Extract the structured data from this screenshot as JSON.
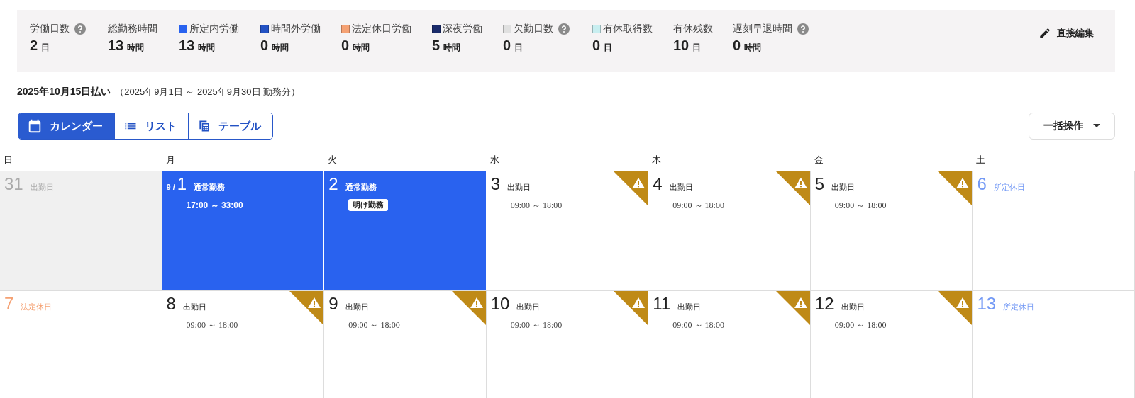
{
  "summary": {
    "items": [
      {
        "label": "労働日数",
        "value": "2",
        "unit": "日",
        "help": true
      },
      {
        "label": "総勤務時間",
        "value": "13",
        "unit": "時間",
        "help": false
      },
      {
        "label": "所定内労働",
        "value": "13",
        "unit": "時間",
        "help": false,
        "color": "#2962ef"
      },
      {
        "label": "時間外労働",
        "value": "0",
        "unit": "時間",
        "help": false,
        "color": "#2352c4"
      },
      {
        "label": "法定休日労働",
        "value": "0",
        "unit": "時間",
        "help": false,
        "color": "#f5a173"
      },
      {
        "label": "深夜労働",
        "value": "5",
        "unit": "時間",
        "help": false,
        "color": "#1a2b6b"
      },
      {
        "label": "欠勤日数",
        "value": "0",
        "unit": "日",
        "help": true,
        "color": "#e0e0e0"
      },
      {
        "label": "有休取得数",
        "value": "0",
        "unit": "日",
        "help": false,
        "color": "#c8eef0"
      },
      {
        "label": "有休残数",
        "value": "10",
        "unit": "日",
        "help": false
      },
      {
        "label": "遅刻早退時間",
        "value": "0",
        "unit": "時間",
        "help": true
      }
    ],
    "edit_button": "直接編集"
  },
  "period": {
    "title": "2025年10月15日払い",
    "range": "（2025年9月1日 ～ 2025年9月30日 勤務分）"
  },
  "views": [
    {
      "label": "カレンダー",
      "selected": true
    },
    {
      "label": "リスト",
      "selected": false
    },
    {
      "label": "テーブル",
      "selected": false
    }
  ],
  "bulk_button": "一括操作",
  "weekdays": [
    "日",
    "月",
    "火",
    "水",
    "木",
    "金",
    "土"
  ],
  "weeks": [
    [
      {
        "day": "31",
        "kind": "outside",
        "label": "出勤日",
        "selected": false,
        "warning": false
      },
      {
        "day": "1",
        "prefix": "9 /",
        "kind": "workday",
        "label": "通常勤務",
        "time": "17:00 ～ 33:00",
        "selected": true,
        "warning": false
      },
      {
        "day": "2",
        "kind": "workday",
        "label": "通常勤務",
        "badge": "明け勤務",
        "selected": true,
        "warning": false
      },
      {
        "day": "3",
        "kind": "workday",
        "label": "出勤日",
        "time": "09:00 ～ 18:00",
        "selected": false,
        "warning": true
      },
      {
        "day": "4",
        "kind": "workday",
        "label": "出勤日",
        "time": "09:00 ～ 18:00",
        "selected": false,
        "warning": true
      },
      {
        "day": "5",
        "kind": "workday",
        "label": "出勤日",
        "time": "09:00 ～ 18:00",
        "selected": false,
        "warning": true
      },
      {
        "day": "6",
        "kind": "scheduled_holiday",
        "label": "所定休日",
        "selected": false,
        "warning": false
      }
    ],
    [
      {
        "day": "7",
        "kind": "legal_holiday",
        "label": "法定休日",
        "selected": false,
        "warning": false
      },
      {
        "day": "8",
        "kind": "workday",
        "label": "出勤日",
        "time": "09:00 ～ 18:00",
        "selected": false,
        "warning": true
      },
      {
        "day": "9",
        "kind": "workday",
        "label": "出勤日",
        "time": "09:00 ～ 18:00",
        "selected": false,
        "warning": true
      },
      {
        "day": "10",
        "kind": "workday",
        "label": "出勤日",
        "time": "09:00 ～ 18:00",
        "selected": false,
        "warning": true
      },
      {
        "day": "11",
        "kind": "workday",
        "label": "出勤日",
        "time": "09:00 ～ 18:00",
        "selected": false,
        "warning": true
      },
      {
        "day": "12",
        "kind": "workday",
        "label": "出勤日",
        "time": "09:00 ～ 18:00",
        "selected": false,
        "warning": true
      },
      {
        "day": "13",
        "kind": "scheduled_holiday",
        "label": "所定休日",
        "selected": false,
        "warning": false
      }
    ]
  ]
}
